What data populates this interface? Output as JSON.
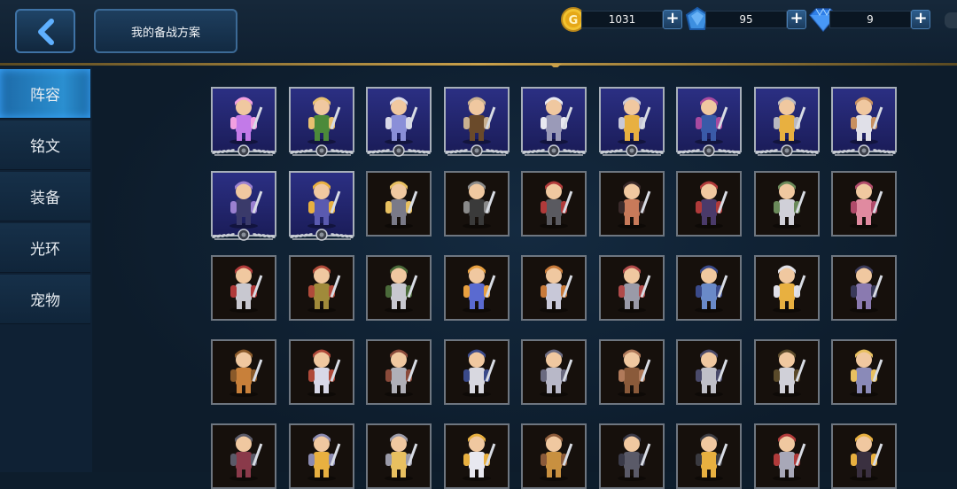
{
  "header": {
    "back_icon": "chevron-left-icon",
    "plan_button_label": "我的备战方案",
    "currencies": [
      {
        "name": "gold",
        "icon": "gold-coin-icon",
        "value": "1031",
        "color": "#f2c230"
      },
      {
        "name": "crystal",
        "icon": "blue-crystal-icon",
        "value": "95",
        "color": "#3d8fe0"
      },
      {
        "name": "diamond",
        "icon": "diamond-icon",
        "value": "9",
        "color": "#2f7fe8"
      }
    ],
    "plus_label": "+"
  },
  "sidebar": {
    "items": [
      {
        "label": "阵容",
        "active": true
      },
      {
        "label": "铭文",
        "active": false
      },
      {
        "label": "装备",
        "active": false
      },
      {
        "label": "光环",
        "active": false
      },
      {
        "label": "宠物",
        "active": false
      }
    ]
  },
  "heroes": {
    "rows": [
      [
        {
          "icon": "purple-crystal-hero-icon",
          "owned": true,
          "colors": [
            "#c27ae8",
            "#f2a0e0"
          ]
        },
        {
          "icon": "green-ranger-hero-icon",
          "owned": true,
          "colors": [
            "#4c8a3a",
            "#e8c070"
          ]
        },
        {
          "icon": "ponytail-warrior-hero-icon",
          "owned": true,
          "colors": [
            "#8a8fd8",
            "#d8d8e8"
          ]
        },
        {
          "icon": "swordsman-hero-icon",
          "owned": true,
          "colors": [
            "#6a4a2a",
            "#c8b090"
          ]
        },
        {
          "icon": "white-hair-knight-hero-icon",
          "owned": true,
          "colors": [
            "#9a9ab8",
            "#e8e8f0"
          ]
        },
        {
          "icon": "blond-paladin-hero-icon",
          "owned": true,
          "colors": [
            "#e8b040",
            "#c8c8d8"
          ]
        },
        {
          "icon": "winged-succubus-hero-icon",
          "owned": true,
          "colors": [
            "#3a5aa8",
            "#a84aa0"
          ]
        },
        {
          "icon": "golden-barbarian-hero-icon",
          "owned": true,
          "colors": [
            "#e8b040",
            "#b8b8c0"
          ]
        },
        {
          "icon": "white-beast-hero-icon",
          "owned": true,
          "colors": [
            "#e0e0e8",
            "#c89060"
          ]
        }
      ],
      [
        {
          "icon": "dark-knight-hero-icon",
          "owned": true,
          "colors": [
            "#3a3a6a",
            "#9a80d0"
          ]
        },
        {
          "icon": "blond-spearman-hero-icon",
          "owned": true,
          "colors": [
            "#5a5ab0",
            "#e8b040"
          ]
        },
        {
          "icon": "armored-blond-hero-icon",
          "owned": false,
          "colors": [
            "#7a7a88",
            "#e8c060"
          ]
        },
        {
          "icon": "masked-ninja-hero-icon",
          "owned": false,
          "colors": [
            "#3a3a3a",
            "#8a8a8a"
          ]
        },
        {
          "icon": "red-armor-knight-hero-icon",
          "owned": false,
          "colors": [
            "#5a5a60",
            "#b03a3a"
          ]
        },
        {
          "icon": "brawler-hero-icon",
          "owned": false,
          "colors": [
            "#c87a5a",
            "#3a2a2a"
          ]
        },
        {
          "icon": "vampire-hero-icon",
          "owned": false,
          "colors": [
            "#4a3a6a",
            "#b03a3a"
          ]
        },
        {
          "icon": "heavy-knight-hero-icon",
          "owned": false,
          "colors": [
            "#d0d0d8",
            "#6a8a5a"
          ]
        },
        {
          "icon": "pink-witch-hero-icon",
          "owned": false,
          "colors": [
            "#e08aa0",
            "#b04a6a"
          ]
        }
      ],
      [
        {
          "icon": "great-sword-knight-hero-icon",
          "owned": false,
          "colors": [
            "#c8c8d0",
            "#b03a3a"
          ]
        },
        {
          "icon": "helmet-soldier-hero-icon",
          "owned": false,
          "colors": [
            "#a08a3a",
            "#b04a3a"
          ]
        },
        {
          "icon": "broadsword-warrior-hero-icon",
          "owned": false,
          "colors": [
            "#c8c8d0",
            "#4a6a3a"
          ]
        },
        {
          "icon": "blue-hair-fighter-hero-icon",
          "owned": false,
          "colors": [
            "#5a6ad0",
            "#e8a040"
          ]
        },
        {
          "icon": "winged-harpy-hero-icon",
          "owned": false,
          "colors": [
            "#c8c8d8",
            "#c87a3a"
          ]
        },
        {
          "icon": "archer-hero-icon",
          "owned": false,
          "colors": [
            "#9a9aa8",
            "#b04a4a"
          ]
        },
        {
          "icon": "lizard-beast-hero-icon",
          "owned": false,
          "colors": [
            "#6a8ac8",
            "#3a4a8a"
          ]
        },
        {
          "icon": "golden-cavalry-hero-icon",
          "owned": false,
          "colors": [
            "#e8b040",
            "#e0e0e8"
          ]
        },
        {
          "icon": "hooded-mage-hero-icon",
          "owned": false,
          "colors": [
            "#8a7ab0",
            "#3a3a5a"
          ]
        }
      ],
      [
        {
          "icon": "rock-golem-hero-icon",
          "owned": false,
          "colors": [
            "#c8803a",
            "#8a5a2a"
          ]
        },
        {
          "icon": "white-hair-swordsman-hero-icon",
          "owned": false,
          "colors": [
            "#d8d8e8",
            "#b04a3a"
          ]
        },
        {
          "icon": "horned-warrior-hero-icon",
          "owned": false,
          "colors": [
            "#b0b0b8",
            "#8a4a3a"
          ]
        },
        {
          "icon": "elder-cavalry-hero-icon",
          "owned": false,
          "colors": [
            "#d8d8e0",
            "#3a4a8a"
          ]
        },
        {
          "icon": "hooded-ninja-hero-icon",
          "owned": false,
          "colors": [
            "#b8b8c8",
            "#6a6a80"
          ]
        },
        {
          "icon": "brown-bear-hero-icon",
          "owned": false,
          "colors": [
            "#8a5a3a",
            "#b07a5a"
          ]
        },
        {
          "icon": "silver-swordsman-hero-icon",
          "owned": false,
          "colors": [
            "#c0c0c8",
            "#4a4a6a"
          ]
        },
        {
          "icon": "winged-helm-knight-hero-icon",
          "owned": false,
          "colors": [
            "#d0d0d8",
            "#5a4a2a"
          ]
        },
        {
          "icon": "staff-sorceress-hero-icon",
          "owned": false,
          "colors": [
            "#8a8ab8",
            "#e8c060"
          ]
        }
      ],
      [
        {
          "icon": "crimson-knight-hero-icon",
          "owned": false,
          "colors": [
            "#8a3a4a",
            "#5a5a68"
          ]
        },
        {
          "icon": "young-swordsman-hero-icon",
          "owned": false,
          "colors": [
            "#e8b040",
            "#8a8ab0"
          ]
        },
        {
          "icon": "golden-helm-hero-icon",
          "owned": false,
          "colors": [
            "#e8c060",
            "#9a9aa8"
          ]
        },
        {
          "icon": "white-cleric-hero-icon",
          "owned": false,
          "colors": [
            "#e8e8f0",
            "#e8b040"
          ]
        },
        {
          "icon": "horned-brute-hero-icon",
          "owned": false,
          "colors": [
            "#c89040",
            "#8a5a3a"
          ]
        },
        {
          "icon": "iron-golem-hero-icon",
          "owned": false,
          "colors": [
            "#5a5a68",
            "#3a3a48"
          ]
        },
        {
          "icon": "samurai-hero-icon",
          "owned": false,
          "colors": [
            "#e8b040",
            "#3a3a40"
          ]
        },
        {
          "icon": "plumed-knight-hero-icon",
          "owned": false,
          "colors": [
            "#a8a8b8",
            "#b03a3a"
          ]
        },
        {
          "icon": "dark-lord-hero-icon",
          "owned": false,
          "colors": [
            "#3a3040",
            "#e8b040"
          ]
        }
      ]
    ]
  }
}
